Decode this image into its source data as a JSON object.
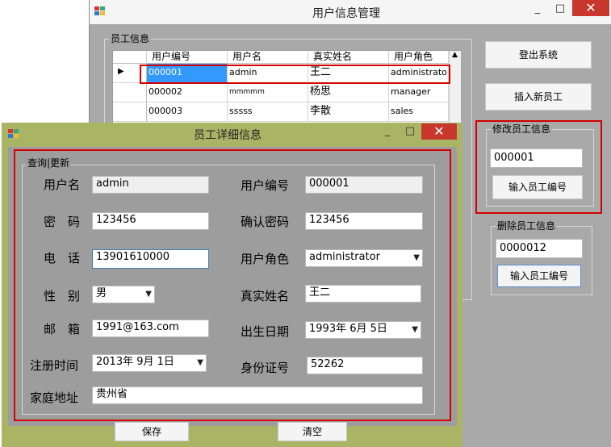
{
  "main_window": {
    "title": "用户信息管理",
    "employee_group_label": "员工信息",
    "grid": {
      "columns": [
        "用户编号",
        "用户名",
        "真实姓名",
        "用户角色"
      ],
      "rows": [
        [
          "000001",
          "admin",
          "王二",
          "administrato"
        ],
        [
          "000002",
          "mmmmm",
          "杨思",
          "manager"
        ],
        [
          "000003",
          "sssss",
          "李散",
          "sales"
        ]
      ],
      "selected_row_marker": "▶"
    },
    "logout_button": "登出系统",
    "insert_button": "插入新员工",
    "modify_group": {
      "label": "修改员工信息",
      "value": "000001",
      "button": "输入员工编号"
    },
    "delete_group": {
      "label": "删除员工信息",
      "value": "0000012",
      "button": "输入员工编号"
    }
  },
  "detail_window": {
    "title": "员工详细信息",
    "group_label": "查询|更新",
    "fields": {
      "username": {
        "label": "用户名",
        "value": "admin"
      },
      "user_id": {
        "label": "用户编号",
        "value": "000001"
      },
      "password": {
        "label": "密　码",
        "value": "123456"
      },
      "confirm_password": {
        "label": "确认密码",
        "value": "123456"
      },
      "phone": {
        "label": "电　话",
        "value": "13901610000"
      },
      "role": {
        "label": "用户角色",
        "value": "administrator"
      },
      "gender": {
        "label": "性　别",
        "value": "男"
      },
      "real_name": {
        "label": "真实姓名",
        "value": "王二"
      },
      "email": {
        "label": "邮　箱",
        "value": "1991@163.com"
      },
      "birth_date": {
        "label": "出生日期",
        "value": "1993年 6月 5日"
      },
      "register_time": {
        "label": "注册时间",
        "value": "2013年 9月 1日"
      },
      "id_number": {
        "label": "身份证号",
        "value": "52262"
      },
      "address": {
        "label": "家庭地址",
        "value": "贵州省"
      }
    },
    "save_button": "保存",
    "clear_button": "清空"
  },
  "window_controls": {
    "minimize": "_",
    "maximize": "□",
    "close": "✕"
  },
  "colors": {
    "highlight_red": "#d40000",
    "selected_cell": "#3399ff",
    "detail_frame": "#a9b565",
    "main_bg": "#a9a9a9"
  }
}
